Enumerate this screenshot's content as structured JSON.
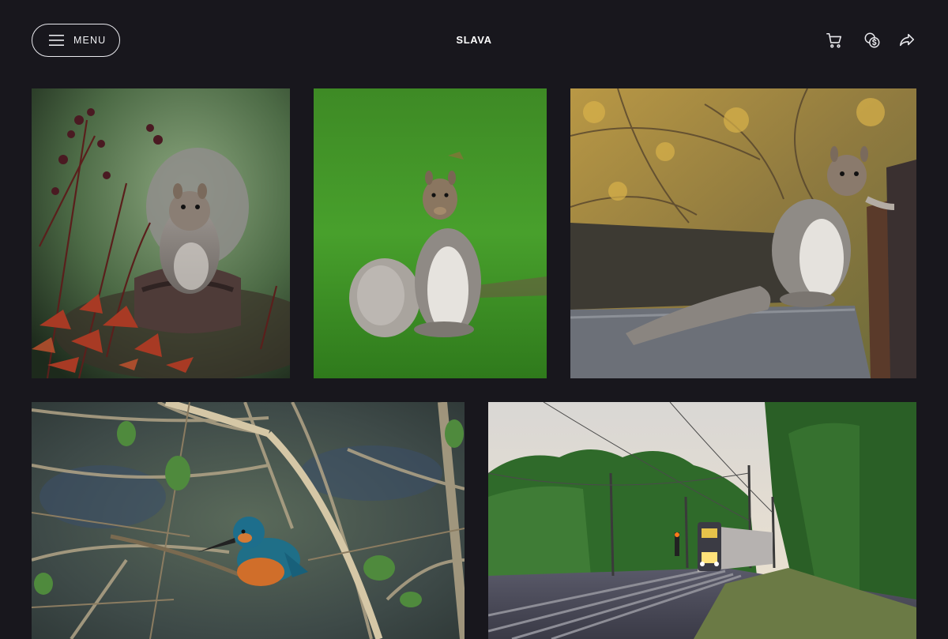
{
  "header": {
    "menu_label": "MENU",
    "brand": "SLAVA",
    "icons": [
      "hamburger-icon",
      "cart-icon",
      "currency-exchange-icon",
      "share-icon"
    ]
  },
  "gallery": {
    "items": [
      {
        "subject": "squirrel-on-post-with-autumn-leaves"
      },
      {
        "subject": "squirrel-standing-on-grass"
      },
      {
        "subject": "squirrel-on-fence-autumn"
      },
      {
        "subject": "kingfisher-on-branch"
      },
      {
        "subject": "train-on-railway-tracks"
      }
    ]
  },
  "colors": {
    "background": "#18171d",
    "text": "#ffffff",
    "button_border": "#e9e9ee"
  }
}
